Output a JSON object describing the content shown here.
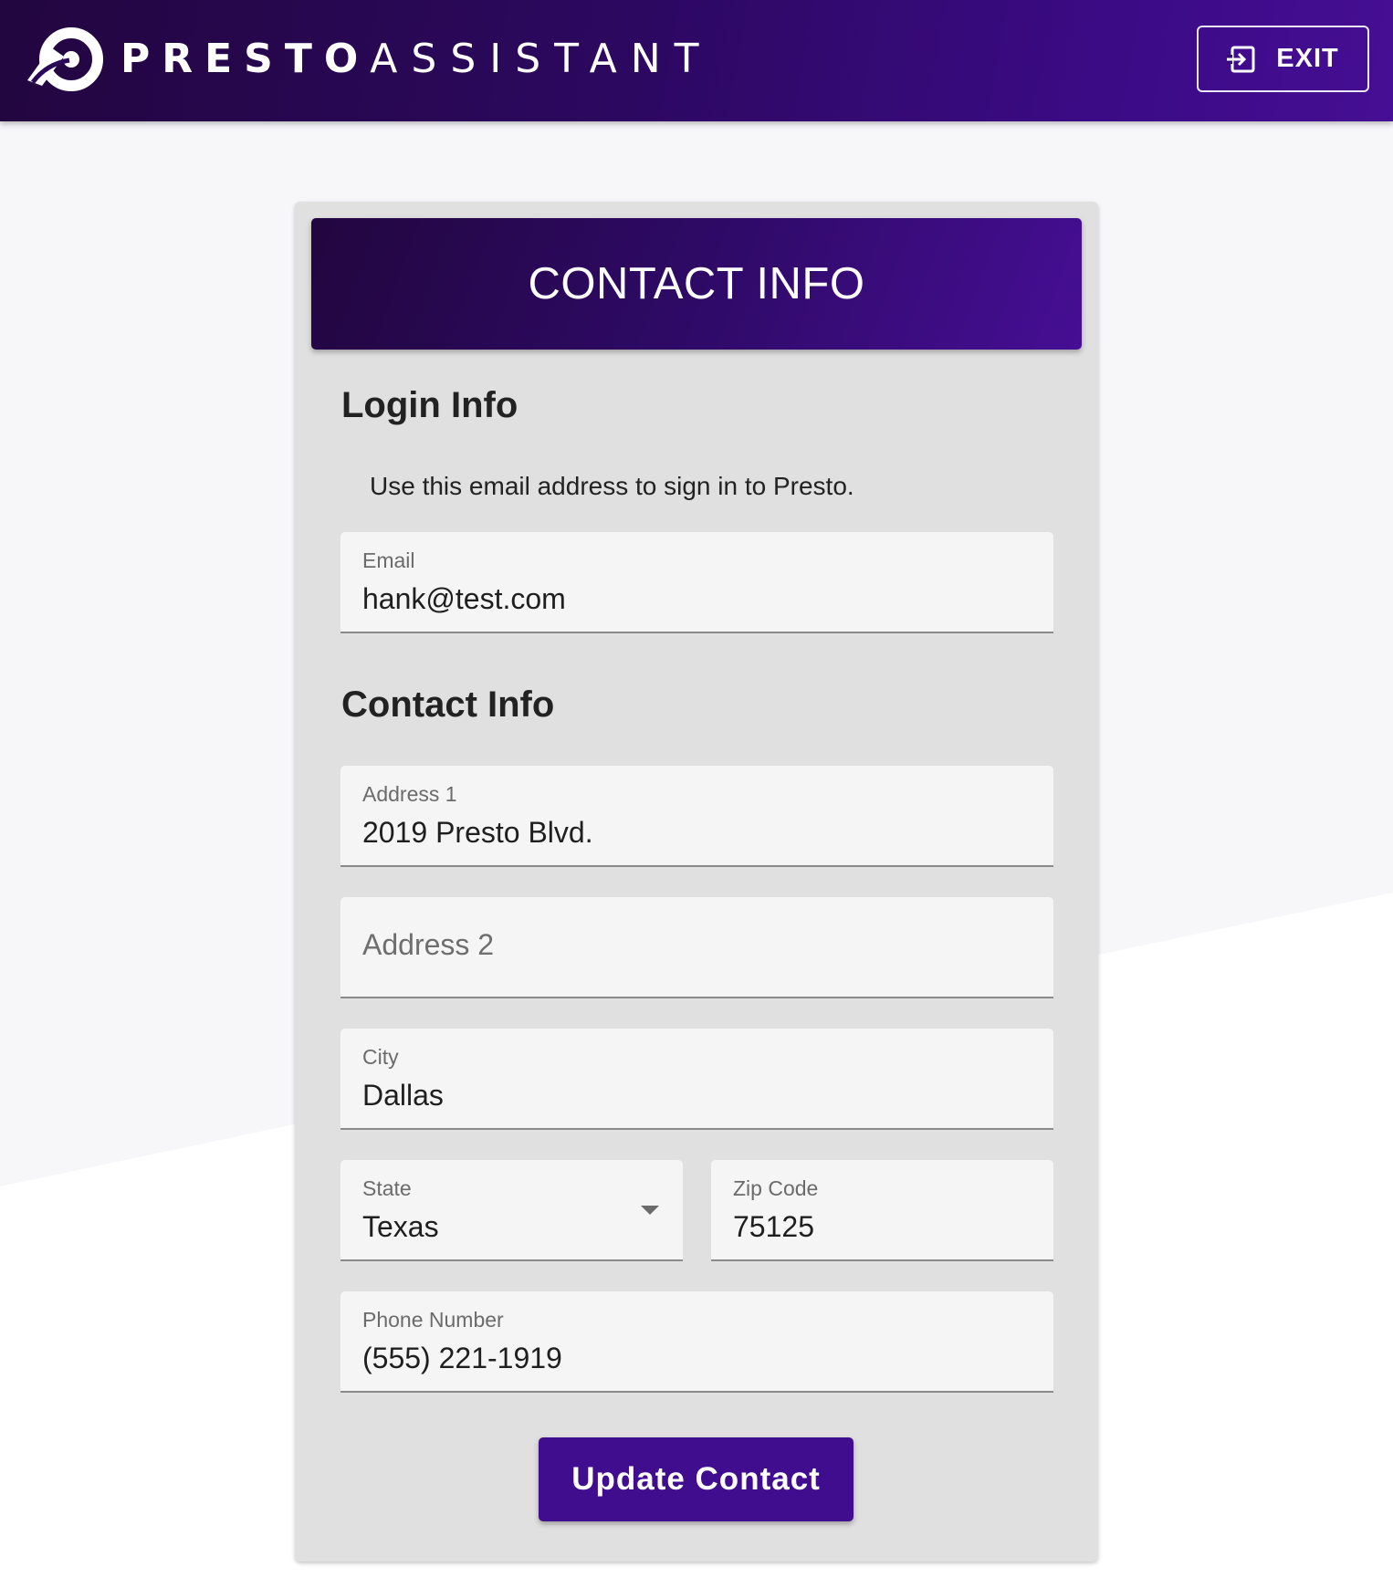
{
  "header": {
    "brand_bold": "PRESTO",
    "brand_light": "ASSISTANT",
    "exit_label": "EXIT"
  },
  "card": {
    "title": "CONTACT INFO",
    "login_section_title": "Login Info",
    "login_hint": "Use this email address to sign in to Presto.",
    "contact_section_title": "Contact Info",
    "fields": {
      "email": {
        "label": "Email",
        "value": "hank@test.com"
      },
      "address1": {
        "label": "Address 1",
        "value": "2019 Presto Blvd."
      },
      "address2": {
        "placeholder": "Address 2",
        "value": ""
      },
      "city": {
        "label": "City",
        "value": "Dallas"
      },
      "state": {
        "label": "State",
        "value": "Texas"
      },
      "zip": {
        "label": "Zip Code",
        "value": "75125"
      },
      "phone": {
        "label": "Phone Number",
        "value": "(555) 221-1919"
      }
    },
    "submit_label": "Update Contact"
  },
  "colors": {
    "brand_dark": "#22063f",
    "brand_purple": "#460e94",
    "button_purple": "#3f0d8e",
    "card_bg": "#e0e0e0",
    "field_bg": "#f5f5f5"
  },
  "icons": {
    "logo": "presto-logo-icon",
    "exit": "exit-door-icon",
    "dropdown": "caret-down-icon"
  }
}
